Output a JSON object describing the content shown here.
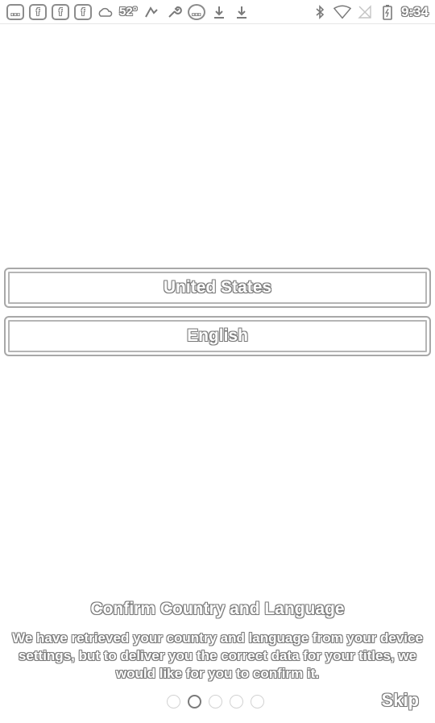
{
  "status_bar": {
    "left_icons": [
      {
        "name": "chat-icon",
        "glyph": "…"
      },
      {
        "name": "facebook-icon",
        "glyph": "f"
      },
      {
        "name": "facebook-icon",
        "glyph": "f"
      },
      {
        "name": "facebook-icon",
        "glyph": "f"
      },
      {
        "name": "weather-icon",
        "glyph": "☁"
      }
    ],
    "temperature": "52°",
    "right_extra_icons": [
      {
        "name": "wrench-icon",
        "glyph": "🔧"
      },
      {
        "name": "voicemail-icon",
        "glyph": "…"
      },
      {
        "name": "download-icon",
        "glyph": "⤓"
      },
      {
        "name": "download-icon",
        "glyph": "⤓"
      }
    ],
    "time": "9:34"
  },
  "country": "United States",
  "language": "English",
  "title": "Confirm Country and Language",
  "description": "We have retrieved your country and language from your device settings, but to deliver you the correct data for your titles, we would like for you to confirm it.",
  "pager": {
    "count": 5,
    "active_index": 1
  },
  "skip_label": "Skip"
}
